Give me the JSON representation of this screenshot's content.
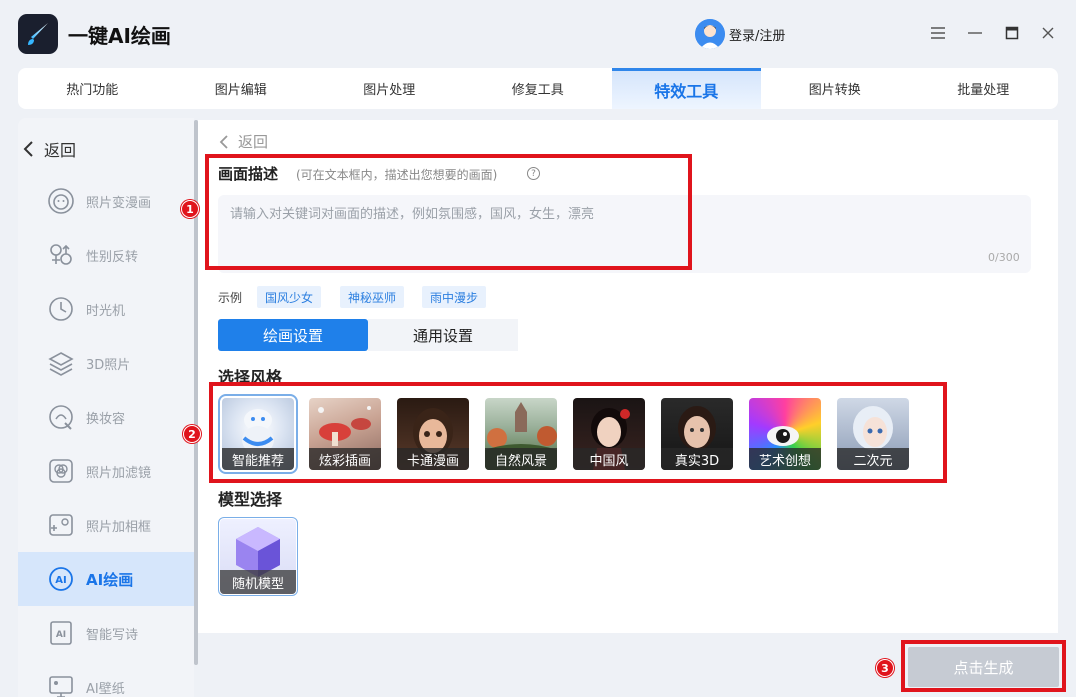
{
  "app": {
    "title": "一键AI绘画",
    "login_text": "登录/注册"
  },
  "window_controls": [
    "menu-icon",
    "minimize-icon",
    "maximize-icon",
    "close-icon"
  ],
  "tabs": [
    {
      "label": "热门功能",
      "active": false
    },
    {
      "label": "图片编辑",
      "active": false
    },
    {
      "label": "图片处理",
      "active": false
    },
    {
      "label": "修复工具",
      "active": false
    },
    {
      "label": "特效工具",
      "active": true
    },
    {
      "label": "图片转换",
      "active": false
    },
    {
      "label": "批量处理",
      "active": false
    }
  ],
  "sidebar": {
    "back_label": "返回",
    "items": [
      {
        "label": "照片变漫画",
        "icon": "cartoon-face-icon",
        "active": false
      },
      {
        "label": "性别反转",
        "icon": "gender-icon",
        "active": false
      },
      {
        "label": "时光机",
        "icon": "clock-icon",
        "active": false
      },
      {
        "label": "3D照片",
        "icon": "layers-icon",
        "active": false
      },
      {
        "label": "换妆容",
        "icon": "makeup-icon",
        "active": false
      },
      {
        "label": "照片加滤镜",
        "icon": "filter-icon",
        "active": false
      },
      {
        "label": "照片加相框",
        "icon": "frame-icon",
        "active": false
      },
      {
        "label": "AI绘画",
        "icon": "ai-paint-icon",
        "active": true
      },
      {
        "label": "智能写诗",
        "icon": "ai-poem-icon",
        "active": false
      },
      {
        "label": "AI壁纸",
        "icon": "wallpaper-icon",
        "active": false
      }
    ]
  },
  "main": {
    "back_label": "返回",
    "description": {
      "title": "画面描述",
      "hint": "(可在文本框内，描述出您想要的画面)",
      "placeholder": "请输入对关键词对画面的描述，例如氛围感，国风，女生，漂亮",
      "value": "",
      "counter": "0/300"
    },
    "examples": {
      "label": "示例",
      "items": [
        "国风少女",
        "神秘巫师",
        "雨中漫步"
      ]
    },
    "settings_tabs": [
      {
        "label": "绘画设置",
        "active": true
      },
      {
        "label": "通用设置",
        "active": false
      }
    ],
    "style_section_title": "选择风格",
    "styles": [
      {
        "label": "智能推荐",
        "selected": true
      },
      {
        "label": "炫彩插画",
        "selected": false
      },
      {
        "label": "卡通漫画",
        "selected": false
      },
      {
        "label": "自然风景",
        "selected": false
      },
      {
        "label": "中国风",
        "selected": false
      },
      {
        "label": "真实3D",
        "selected": false
      },
      {
        "label": "艺术创想",
        "selected": false
      },
      {
        "label": "二次元",
        "selected": false
      }
    ],
    "model_section_title": "模型选择",
    "models": [
      {
        "label": "随机模型",
        "selected": true
      }
    ],
    "generate_button": "点击生成"
  },
  "annotations": [
    "1",
    "2",
    "3"
  ],
  "colors": {
    "accent": "#1f80ea",
    "annotation_red": "#e0141c",
    "generate_disabled": "#c6cbd3"
  }
}
